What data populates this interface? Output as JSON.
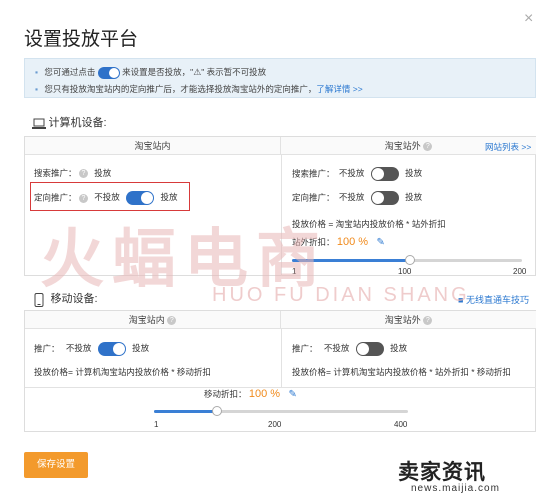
{
  "dialog": {
    "title": "设置投放平台",
    "close": "×"
  },
  "info": {
    "line1_a": "您可通过点击",
    "line1_b": "来设置是否投放，\"",
    "line1_c": "\" 表示暂不可投放",
    "line2_a": "您只有投放淘宝站内的定向推广后，才能选择投放淘宝站外的定向推广，",
    "line2_link": "了解详情 >>"
  },
  "computer": {
    "heading": "计算机设备:",
    "inside": {
      "header": "淘宝站内",
      "search_label": "搜索推广：",
      "search_value": "投放",
      "target_label": "定向推广：",
      "target_off": "不投放",
      "target_on": "投放"
    },
    "outside": {
      "header": "淘宝站外",
      "site_list_link": "网站列表 >>",
      "search_label": "搜索推广：",
      "search_off": "不投放",
      "search_on": "投放",
      "target_label": "定向推广：",
      "target_off": "不投放",
      "target_on": "投放",
      "price_formula": "投放价格 = 淘宝站内投放价格 * 站外折扣",
      "discount_label": "站外折扣：",
      "discount_value": "100 %",
      "slider": {
        "min": "1",
        "mid": "100",
        "max": "200",
        "value": 100
      }
    }
  },
  "mobile": {
    "heading": "移动设备:",
    "tips_link": "无线直通车技巧",
    "inside": {
      "header": "淘宝站内",
      "promo_label": "推广：",
      "promo_off": "不投放",
      "promo_on": "投放",
      "price_formula": "投放价格= 计算机淘宝站内投放价格 * 移动折扣"
    },
    "outside": {
      "header": "淘宝站外",
      "promo_label": "推广：",
      "promo_off": "不投放",
      "promo_on": "投放",
      "price_formula": "投放价格= 计算机淘宝站内投放价格 * 站外折扣 * 移动折扣"
    },
    "discount_label": "移动折扣：",
    "discount_value": "100 %",
    "slider": {
      "min": "1",
      "mid": "200",
      "max": "400",
      "value": 100
    }
  },
  "footer": {
    "save_label": "保存设置"
  },
  "watermark": {
    "logo_cn": "火蝠电商",
    "logo_en": "HUO FU DIAN SHANG"
  },
  "branding": {
    "name": "卖家资讯",
    "url": "news.maijia.com"
  },
  "colors": {
    "accent": "#2f72c9",
    "save": "#f39a2c",
    "highlight": "#d73a3a",
    "discount": "#f08a1c"
  }
}
